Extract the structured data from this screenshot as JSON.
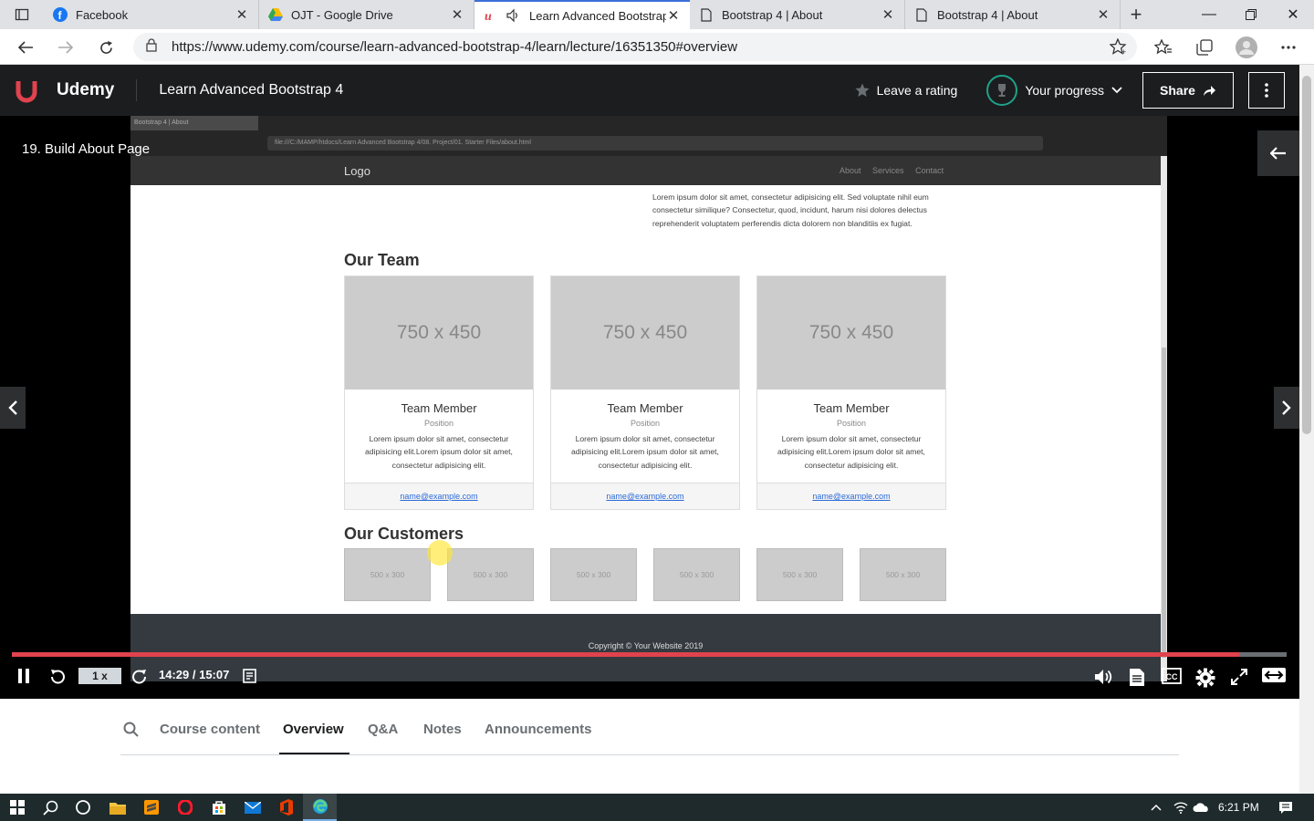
{
  "browser": {
    "tabs": [
      {
        "title": "Facebook"
      },
      {
        "title": "OJT - Google Drive"
      },
      {
        "title": "Learn Advanced Bootstrap"
      },
      {
        "title": "Bootstrap 4 | About"
      },
      {
        "title": "Bootstrap 4 | About"
      }
    ],
    "url": "https://www.udemy.com/course/learn-advanced-bootstrap-4/learn/lecture/16351350#overview"
  },
  "header": {
    "brand": "Udemy",
    "course_title": "Learn Advanced Bootstrap 4",
    "leave_rating": "Leave a rating",
    "your_progress": "Your progress",
    "share": "Share"
  },
  "player": {
    "lecture_title": "19. Build About Page",
    "speed": "1 x",
    "time": "14:29 / 15:07",
    "progress_fraction": 0.9625
  },
  "video": {
    "tab_title": "Bootstrap 4 | About",
    "address": "file:///C:/MAMP/htdocs/Learn Advanced Bootstrap 4/08. Project/01. Starter Files/about.html",
    "logo": "Logo",
    "nav": [
      "About",
      "Services",
      "Contact"
    ],
    "intro": "Lorem ipsum dolor sit amet, consectetur adipisicing elit. Sed voluptate nihil eum consectetur similique? Consectetur, quod, incidunt, harum nisi dolores delectus reprehenderit voluptatem perferendis dicta dolorem non blanditiis ex fugiat.",
    "team_heading": "Our Team",
    "team": [
      {
        "img": "750 x 450",
        "name": "Team Member",
        "position": "Position",
        "desc": "Lorem ipsum dolor sit amet, consectetur adipisicing elit.Lorem ipsum dolor sit amet, consectetur adipisicing elit.",
        "email": "name@example.com"
      },
      {
        "img": "750 x 450",
        "name": "Team Member",
        "position": "Position",
        "desc": "Lorem ipsum dolor sit amet, consectetur adipisicing elit.Lorem ipsum dolor sit amet, consectetur adipisicing elit.",
        "email": "name@example.com"
      },
      {
        "img": "750 x 450",
        "name": "Team Member",
        "position": "Position",
        "desc": "Lorem ipsum dolor sit amet, consectetur adipisicing elit.Lorem ipsum dolor sit amet, consectetur adipisicing elit.",
        "email": "name@example.com"
      }
    ],
    "customers_heading": "Our Customers",
    "customers": [
      "500 x 300",
      "500 x 300",
      "500 x 300",
      "500 x 300",
      "500 x 300",
      "500 x 300"
    ],
    "copyright": "Copyright © Your Website 2019"
  },
  "subtabs": [
    "Course content",
    "Overview",
    "Q&A",
    "Notes",
    "Announcements"
  ],
  "taskbar": {
    "time": "6:21 PM"
  },
  "colors": {
    "udemy_red": "#a435f0",
    "progress_red": "#e0434e",
    "header_bg": "#1c1d1f"
  }
}
